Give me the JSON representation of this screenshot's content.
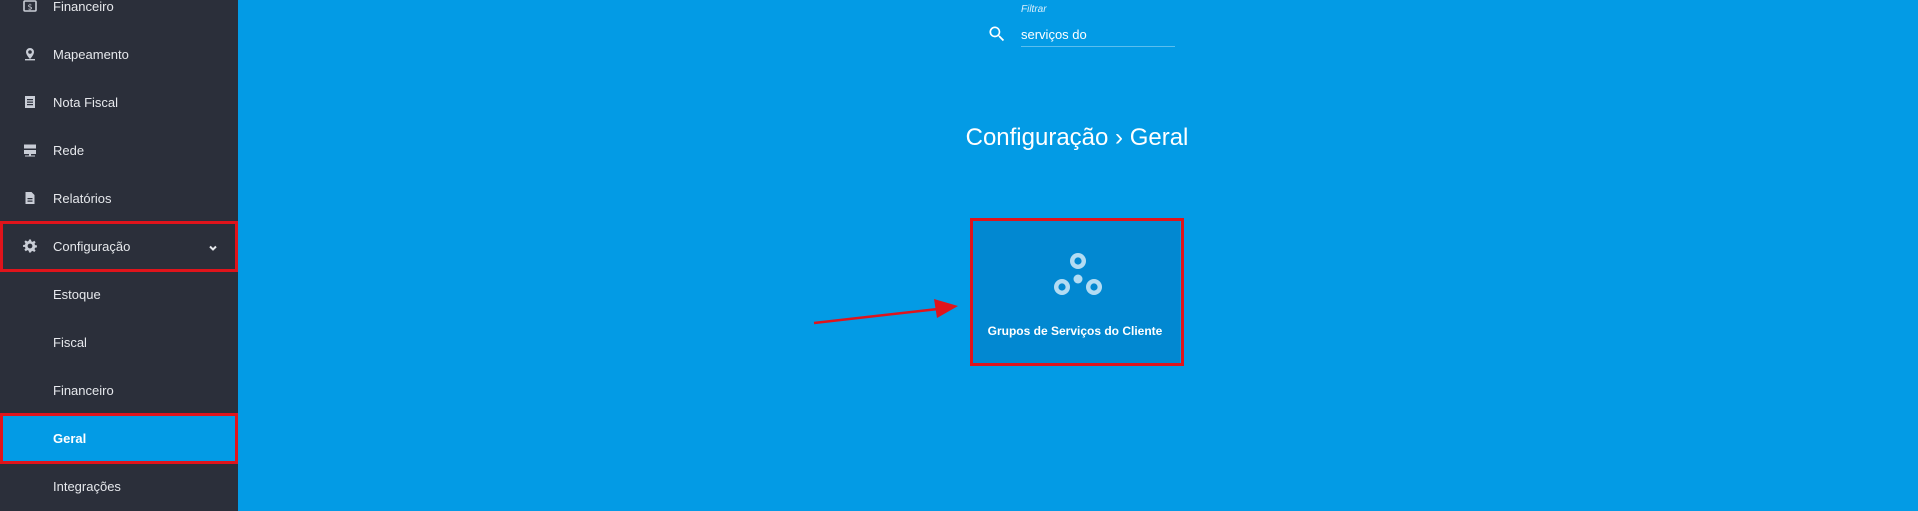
{
  "sidebar": {
    "items": [
      {
        "label": "Financeiro",
        "icon": "money-icon"
      },
      {
        "label": "Mapeamento",
        "icon": "map-pin-icon"
      },
      {
        "label": "Nota Fiscal",
        "icon": "document-list-icon"
      },
      {
        "label": "Rede",
        "icon": "server-icon"
      },
      {
        "label": "Relatórios",
        "icon": "report-file-icon"
      },
      {
        "label": "Configuração",
        "icon": "gear-icon",
        "expanded": true
      }
    ],
    "subitems": [
      {
        "label": "Estoque"
      },
      {
        "label": "Fiscal"
      },
      {
        "label": "Financeiro"
      },
      {
        "label": "Geral",
        "active": true
      },
      {
        "label": "Integrações"
      }
    ]
  },
  "filter": {
    "label": "Filtrar",
    "value": "serviços do"
  },
  "breadcrumb": {
    "text": "Configuração › Geral"
  },
  "tiles": [
    {
      "label": "Grupos de Serviços do Cliente",
      "icon": "circles-group-icon"
    }
  ],
  "colors": {
    "background": "#039be5",
    "sidebar": "#2b2f3a",
    "tile": "#0288d1",
    "highlight": "#e0141b"
  }
}
